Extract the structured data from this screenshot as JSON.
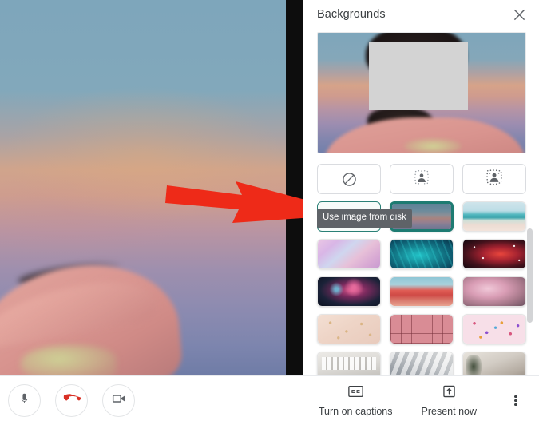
{
  "meeting": {
    "video_tile": {
      "description": "self-view video of a person against a sunset sky virtual background",
      "face_redaction": "gray-box"
    }
  },
  "panel": {
    "title": "Backgrounds",
    "close_icon": "close-icon",
    "preview": {
      "label": "background preview",
      "redaction": "gray-box"
    },
    "tooltip": {
      "text": "Use image from disk",
      "anchor": "add-background-button"
    },
    "rows": [
      {
        "id": "effects-row",
        "tiles": [
          {
            "id": "no-effect",
            "label": "Turn off background effects",
            "kind": "icon",
            "icon": "no-effect-icon",
            "selected": false
          },
          {
            "id": "slight-blur",
            "label": "Slightly blur your background",
            "kind": "icon",
            "icon": "slight-blur-icon",
            "selected": false
          },
          {
            "id": "full-blur",
            "label": "Blur your background",
            "kind": "icon",
            "icon": "full-blur-icon",
            "selected": false
          }
        ]
      },
      {
        "id": "row-2",
        "tiles": [
          {
            "id": "add-background",
            "label": "+",
            "kind": "add",
            "icon": "plus-icon",
            "selected": false
          },
          {
            "id": "bg-sunset-gradient",
            "label": "Sunset gradient background",
            "kind": "image",
            "art": "th-sunset",
            "selected": true
          },
          {
            "id": "bg-beach",
            "label": "Beach background",
            "kind": "image",
            "art": "th-beach",
            "selected": false
          }
        ]
      },
      {
        "id": "row-3",
        "tiles": [
          {
            "id": "bg-pink-clouds",
            "label": "Pink clouds background",
            "kind": "image",
            "art": "th-clouds",
            "selected": false
          },
          {
            "id": "bg-teal-waves",
            "label": "Teal waves background",
            "kind": "image",
            "art": "th-waves",
            "selected": false
          },
          {
            "id": "bg-red-nebula",
            "label": "Red nebula space background",
            "kind": "image",
            "art": "th-nebula",
            "selected": false
          }
        ]
      },
      {
        "id": "row-4",
        "tiles": [
          {
            "id": "bg-fireworks",
            "label": "Fireworks background",
            "kind": "image",
            "art": "th-fire",
            "selected": false
          },
          {
            "id": "bg-red-flowers",
            "label": "Red flowers background",
            "kind": "image",
            "art": "th-flowers",
            "selected": false
          },
          {
            "id": "bg-pink-blossoms",
            "label": "Pink blossoms background",
            "kind": "image",
            "art": "th-blossom",
            "selected": false
          }
        ]
      },
      {
        "id": "row-5",
        "tiles": [
          {
            "id": "bg-beige-confetti",
            "label": "Beige confetti background",
            "kind": "image",
            "art": "th-beige",
            "selected": false
          },
          {
            "id": "bg-pink-grid",
            "label": "Pink grid pattern background",
            "kind": "image",
            "art": "th-grid",
            "selected": false
          },
          {
            "id": "bg-pink-confetti",
            "label": "Pink confetti background",
            "kind": "image",
            "art": "th-pconf",
            "selected": false
          }
        ]
      },
      {
        "id": "row-6",
        "tiles": [
          {
            "id": "bg-office",
            "label": "Office background",
            "kind": "image",
            "art": "th-office",
            "selected": false
          },
          {
            "id": "bg-hallway",
            "label": "Hallway background",
            "kind": "image",
            "art": "th-hall",
            "selected": false
          },
          {
            "id": "bg-lounge",
            "label": "Lounge background",
            "kind": "image",
            "art": "th-lounge",
            "selected": false
          }
        ]
      }
    ]
  },
  "bottom_bar": {
    "call_controls": [
      {
        "id": "microphone",
        "label": "Turn off microphone",
        "icon": "microphone-icon"
      },
      {
        "id": "hang-up",
        "label": "Leave call",
        "icon": "hang-up-icon",
        "color": "#d93025"
      },
      {
        "id": "camera",
        "label": "Turn off camera",
        "icon": "video-camera-icon"
      }
    ],
    "captions": {
      "label": "Turn on captions",
      "icon": "closed-captions-icon"
    },
    "present": {
      "label": "Present now",
      "icon": "present-screen-icon"
    },
    "more": {
      "label": "More options",
      "icon": "more-vertical-icon"
    }
  },
  "annotation": {
    "arrow": {
      "color": "#ee2a18",
      "points_at": "add-background-button"
    }
  }
}
